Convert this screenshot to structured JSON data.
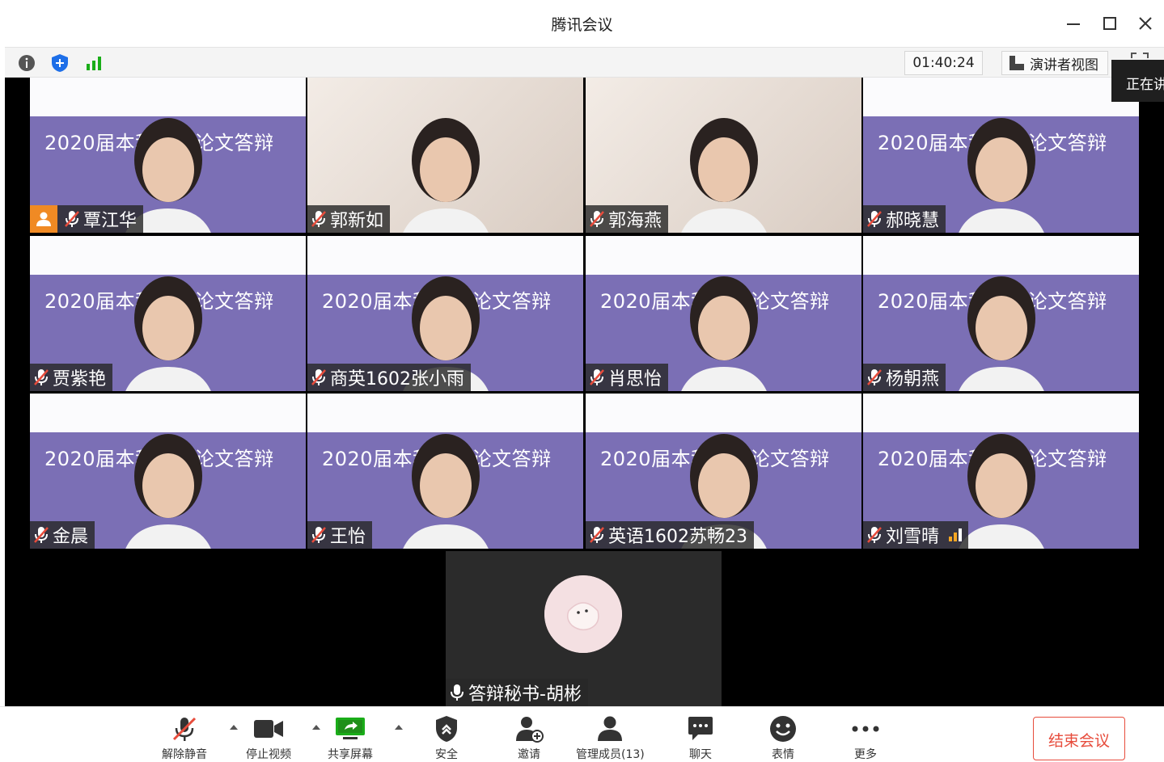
{
  "window": {
    "title": "腾讯会议"
  },
  "subbar": {
    "timer": "01:40:24",
    "speaker_view_label": "演讲者视图",
    "speaking_label": "正在讲"
  },
  "tiles": [
    {
      "name": "覃江华",
      "banner": "2020届本科学位论文答辩",
      "host": true
    },
    {
      "name": "郭新如",
      "banner": ""
    },
    {
      "name": "郭海燕",
      "banner": ""
    },
    {
      "name": "郝晓慧",
      "banner": "2020届本科学位论文答辩"
    },
    {
      "name": "贾紫艳",
      "banner": "2020届本科学位论文答辩"
    },
    {
      "name": "商英1602张小雨",
      "banner": "2020届本科学位论文答辩"
    },
    {
      "name": "肖思怡",
      "banner": "2020届本科学位论文答辩"
    },
    {
      "name": "杨朝燕",
      "banner": "2020届本科学位论文答辩"
    },
    {
      "name": "金晨",
      "banner": "2020届本科学位论文答辩"
    },
    {
      "name": "王怡",
      "banner": "2020届本科学位论文答辩"
    },
    {
      "name": "英语1602苏畅23",
      "banner": "2020届本科学位论文答辩"
    },
    {
      "name": "刘雪晴",
      "banner": "2020届本科学位论文答辩",
      "speaking": true
    }
  ],
  "center_tile": {
    "name": "答辩秘书-胡彬"
  },
  "toolbar": {
    "unmute": "解除静音",
    "stop_video": "停止视频",
    "share_screen": "共享屏幕",
    "security": "安全",
    "invite": "邀请",
    "manage_members": "管理成员(13)",
    "chat": "聊天",
    "reactions": "表情",
    "more": "更多",
    "end_meeting": "结束会议"
  },
  "colors": {
    "accent_end": "#e74c3c",
    "host_badge": "#f08a24",
    "slide_purple": "#7b6fb5"
  }
}
